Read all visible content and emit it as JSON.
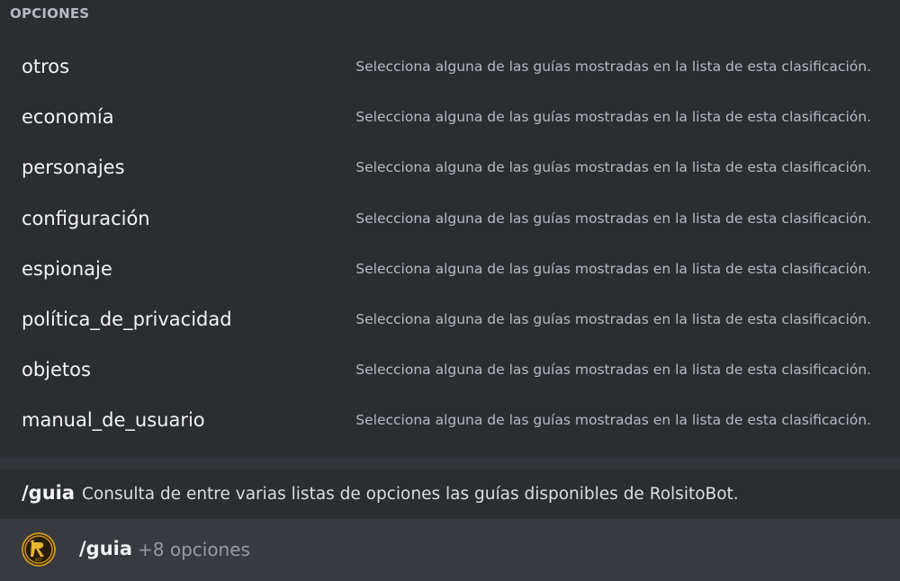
{
  "popout": {
    "header": "OPCIONES",
    "options": [
      {
        "name": "otros",
        "description": "Selecciona alguna de las guías mostradas en la lista de esta clasificación."
      },
      {
        "name": "economía",
        "description": "Selecciona alguna de las guías mostradas en la lista de esta clasificación."
      },
      {
        "name": "personajes",
        "description": "Selecciona alguna de las guías mostradas en la lista de esta clasificación."
      },
      {
        "name": "configuración",
        "description": "Selecciona alguna de las guías mostradas en la lista de esta clasificación."
      },
      {
        "name": "espionaje",
        "description": "Selecciona alguna de las guías mostradas en la lista de esta clasificación."
      },
      {
        "name": "política_de_privacidad",
        "description": "Selecciona alguna de las guías mostradas en la lista de esta clasificación."
      },
      {
        "name": "objetos",
        "description": "Selecciona alguna de las guías mostradas en la lista de esta clasificación."
      },
      {
        "name": "manual_de_usuario",
        "description": "Selecciona alguna de las guías mostradas en la lista de esta clasificación."
      }
    ]
  },
  "command": {
    "name": "/guia",
    "description": "Consulta de entre varias listas de opciones las guías disponibles de RolsitoBot."
  },
  "input": {
    "bot_avatar_icon": "rolsitobot-logo-icon",
    "command": "/guia",
    "hint": "+8 opciones"
  },
  "colors": {
    "background": "#313338",
    "popout": "#2b2d31",
    "input_bar": "#383a40",
    "accent_gold": "#c8951f"
  }
}
